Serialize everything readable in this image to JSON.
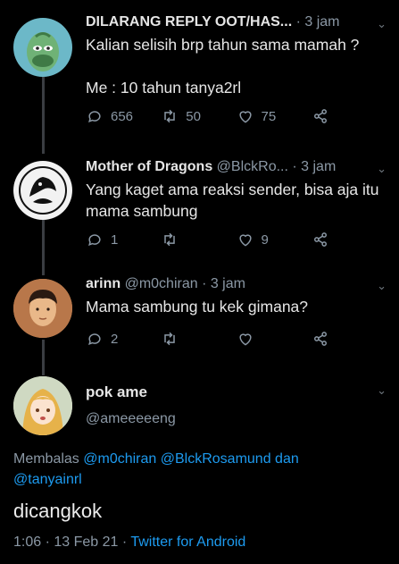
{
  "tweets": [
    {
      "name": "DILARANG REPLY OOT/HAS...",
      "meta": " · 3 jam",
      "text": "Kalian selisih brp tahun sama mamah ?\n\nMe : 10 tahun tanya2rl",
      "replies": "656",
      "retweets": "50",
      "likes": "75"
    },
    {
      "name": "Mother of Dragons",
      "meta": " @BlckRo... · 3 jam",
      "text": "Yang kaget ama reaksi sender, bisa aja itu mama sambung",
      "replies": "1",
      "retweets": "",
      "likes": "9"
    },
    {
      "name": "arinn",
      "meta": " @m0chiran · 3 jam",
      "text": "Mama sambung tu kek gimana?",
      "replies": "2",
      "retweets": "",
      "likes": ""
    }
  ],
  "main": {
    "name": "pok ame",
    "handle": "@ameeeeeng",
    "reply_prefix": "Membalas ",
    "reply_to_1": "@m0chiran",
    "reply_to_2": "@BlckRosamund",
    "reply_and": " dan",
    "reply_to_3": "@tanyainrl",
    "text": "dicangkok",
    "timestamp": "1:06 · 13 Feb 21 · ",
    "source": "Twitter for Android"
  },
  "icons": {
    "reply": "reply-icon",
    "retweet": "retweet-icon",
    "like": "heart-icon",
    "share": "share-icon",
    "more": "chevron-down-icon"
  }
}
